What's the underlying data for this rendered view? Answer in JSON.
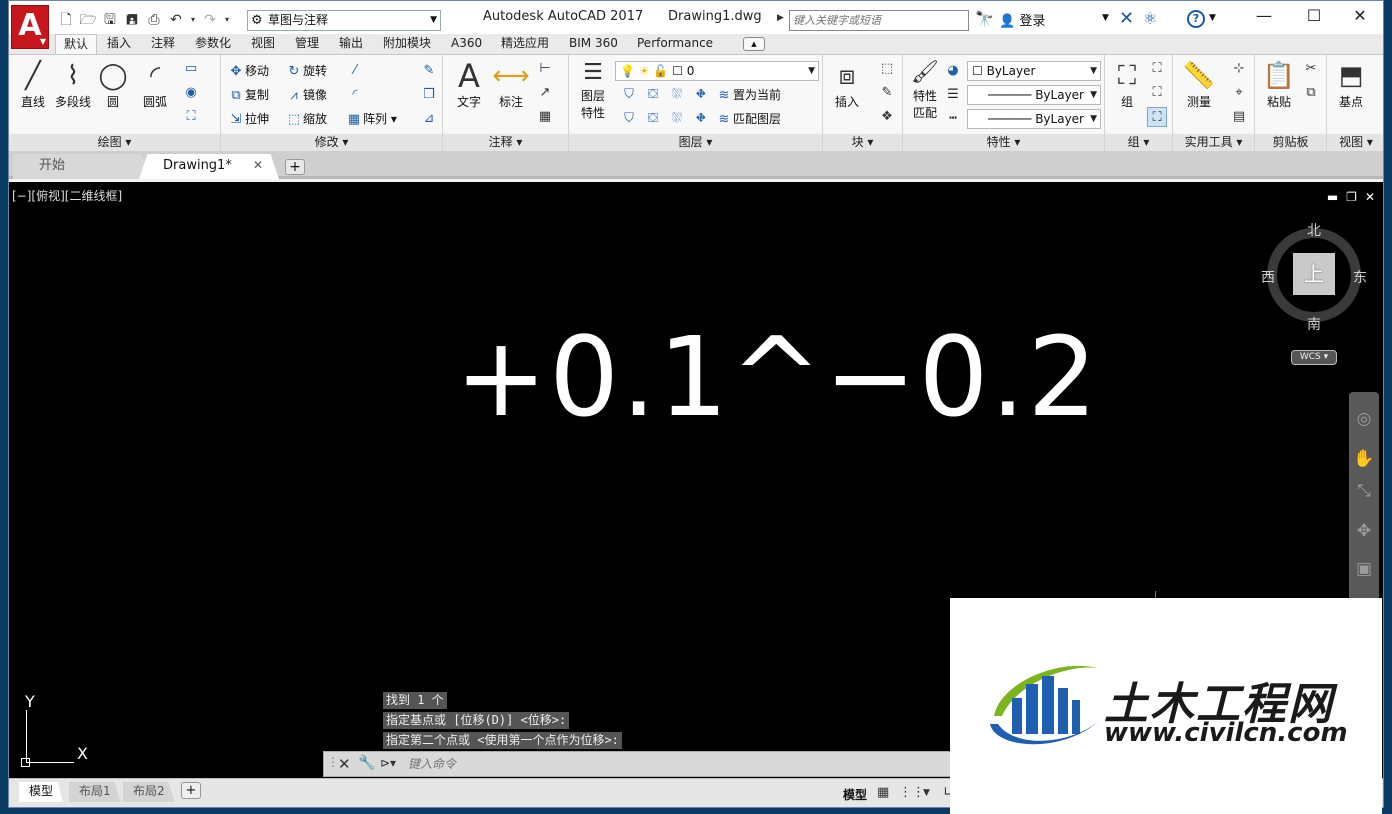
{
  "titlebar": {
    "app_name": "Autodesk AutoCAD 2017",
    "file_name": "Drawing1.dwg",
    "workspace": "草图与注释",
    "search_placeholder": "键入关键字或短语",
    "login": "登录",
    "logo_letter": "A",
    "help": "?"
  },
  "ribbon_tabs": [
    "默认",
    "插入",
    "注释",
    "参数化",
    "视图",
    "管理",
    "输出",
    "附加模块",
    "A360",
    "精选应用",
    "BIM 360",
    "Performance"
  ],
  "panels": {
    "draw": {
      "title": "绘图 ▾",
      "tools": [
        "直线",
        "多段线",
        "圆",
        "圆弧"
      ]
    },
    "modify": {
      "title": "修改 ▾",
      "tools": [
        "移动",
        "旋转",
        "复制",
        "镜像",
        "拉伸",
        "缩放",
        "阵列"
      ]
    },
    "annotation": {
      "title": "注释 ▾",
      "tools": [
        "文字",
        "标注"
      ]
    },
    "layers": {
      "title": "图层 ▾",
      "layer_props_line1": "图层",
      "layer_props_line2": "特性",
      "current_layer": "0",
      "set_current": "置为当前",
      "match_layer": "匹配图层"
    },
    "block": {
      "title": "块 ▾",
      "insert": "插入"
    },
    "properties": {
      "title": "特性 ▾",
      "match_line1": "特性",
      "match_line2": "匹配",
      "color": "ByLayer",
      "linetype": "ByLayer",
      "lineweight": "ByLayer"
    },
    "groups": {
      "title": "组 ▾",
      "group": "组"
    },
    "utilities": {
      "title": "实用工具 ▾",
      "measure": "测量"
    },
    "clipboard": {
      "title": "剪贴板",
      "paste": "粘贴"
    },
    "view": {
      "title": "视图 ▾",
      "base": "基点"
    }
  },
  "doc_tabs": {
    "start": "开始",
    "drawing": "Drawing1*"
  },
  "viewport": {
    "label": "[−][俯视][二维线框]",
    "drawing_text": "+0.1^−0.2",
    "viewcube": {
      "top": "上",
      "north": "北",
      "south": "南",
      "east": "东",
      "west": "西",
      "wcs": "WCS ▾"
    },
    "ucs": {
      "x": "X",
      "y": "Y"
    }
  },
  "command_history": [
    "找到 1 个",
    "指定基点或 [位移(D)] <位移>:",
    "指定第二个点或 <使用第一个点作为位移>:"
  ],
  "command_input_placeholder": "键入命令",
  "layout_tabs": [
    "模型",
    "布局1",
    "布局2"
  ],
  "status": {
    "model": "模型"
  },
  "watermark": {
    "cn": "土木工程网",
    "url": "www.civilcn.com"
  },
  "colors": {
    "viewport_bg": "#000000",
    "brand_red": "#c8161d",
    "accent_blue": "#1c5aa6",
    "wm_blue": "#1f5fb2",
    "wm_green": "#7ab51d"
  }
}
